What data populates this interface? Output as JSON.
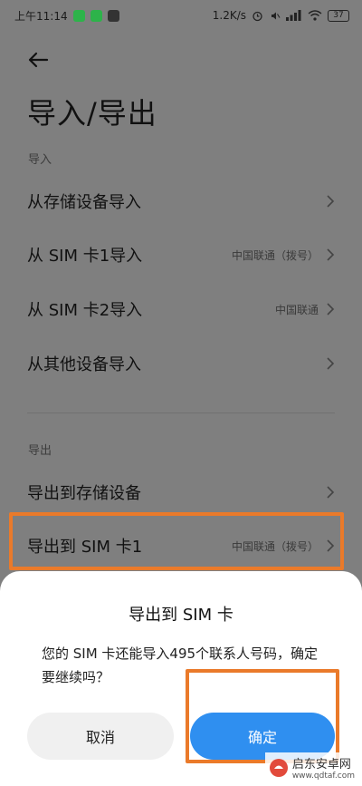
{
  "status_bar": {
    "time": "上午11:14",
    "network_speed": "1.2K/s",
    "battery": "37",
    "icons": [
      "wechat-icon",
      "wechat-icon",
      "app-icon",
      "alarm-icon",
      "mute-icon",
      "signal-icon",
      "wifi-icon",
      "battery-icon"
    ]
  },
  "header": {
    "back_icon": "back-arrow-icon",
    "title": "导入/导出"
  },
  "import_section": {
    "label": "导入",
    "items": [
      {
        "label": "从存储设备导入",
        "value": ""
      },
      {
        "label": "从 SIM 卡1导入",
        "value": "中国联通（拨号）"
      },
      {
        "label": "从 SIM 卡2导入",
        "value": "中国联通"
      },
      {
        "label": "从其他设备导入",
        "value": ""
      }
    ]
  },
  "export_section": {
    "label": "导出",
    "items": [
      {
        "label": "导出到存储设备",
        "value": ""
      },
      {
        "label": "导出到 SIM 卡1",
        "value": "中国联通（拨号）"
      }
    ]
  },
  "dialog": {
    "title": "导出到 SIM 卡",
    "message": "您的 SIM 卡还能导入495个联系人号码，确定要继续吗？",
    "cancel_label": "取消",
    "confirm_label": "确定"
  },
  "watermark": {
    "name": "启东安卓网",
    "url": "www.qdtaf.com"
  },
  "colors": {
    "overlay_bg": "#7f7f7f",
    "accent_blue": "#2f8ff0",
    "highlight_orange": "#ea7a2a"
  }
}
